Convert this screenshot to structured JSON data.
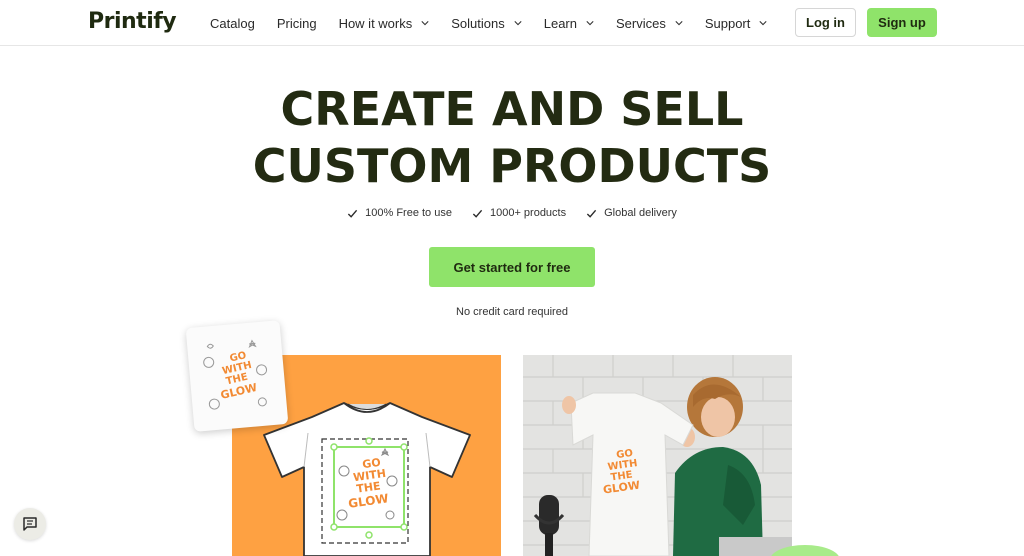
{
  "brand": {
    "name": "Printify"
  },
  "nav": {
    "items": [
      {
        "label": "Catalog",
        "dropdown": false
      },
      {
        "label": "Pricing",
        "dropdown": false
      },
      {
        "label": "How it works",
        "dropdown": true
      },
      {
        "label": "Solutions",
        "dropdown": true
      },
      {
        "label": "Learn",
        "dropdown": true
      },
      {
        "label": "Services",
        "dropdown": true
      },
      {
        "label": "Support",
        "dropdown": true
      }
    ],
    "login_label": "Log in",
    "signup_label": "Sign up"
  },
  "hero": {
    "headline_line1": "CREATE AND SELL",
    "headline_line2": "CUSTOM PRODUCTS",
    "features": [
      "100% Free to use",
      "1000+ products",
      "Global delivery"
    ],
    "cta_label": "Get started for free",
    "note": "No credit card required"
  },
  "artwork": {
    "design_text_lines": [
      "GO",
      "WITH",
      "THE",
      "GLOW"
    ]
  },
  "colors": {
    "accent_green": "#8fe36a",
    "headline_dark": "#232b12",
    "panel_orange": "#fea142"
  },
  "icons": {
    "feature_check": "check-icon",
    "chat": "chat-icon",
    "dropdown": "chevron-down-icon"
  }
}
